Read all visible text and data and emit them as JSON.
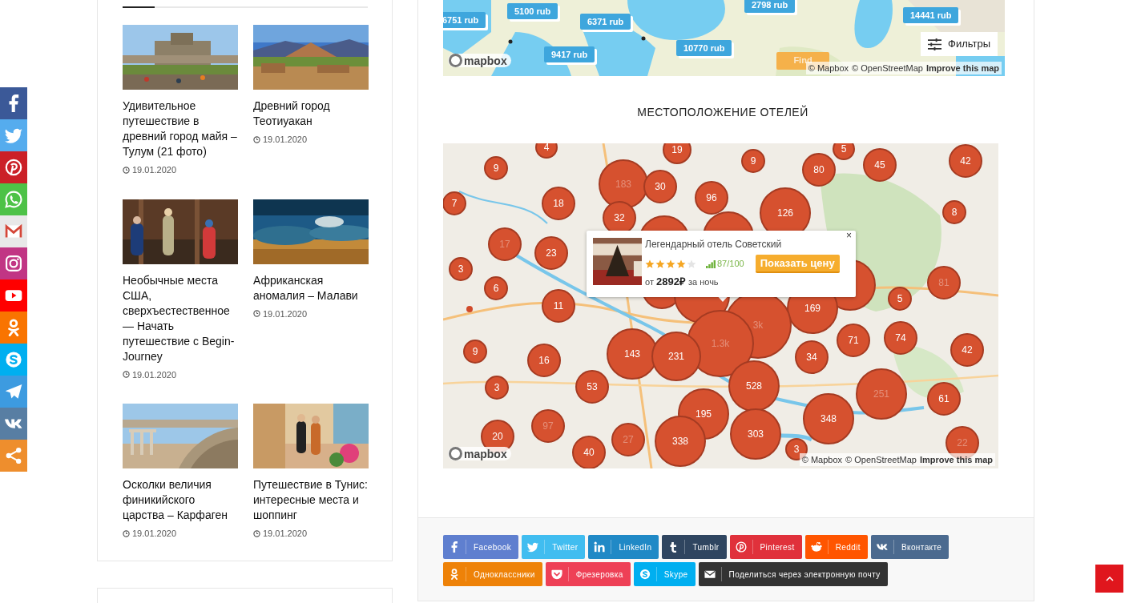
{
  "floating_share": [
    {
      "kind": "facebook",
      "color": "#3b5998"
    },
    {
      "kind": "twitter",
      "color": "#55acee"
    },
    {
      "kind": "pinterest",
      "color": "#cb2027"
    },
    {
      "kind": "whatsapp",
      "color": "#4dc247"
    },
    {
      "kind": "gmail",
      "color": "#e8e8e8"
    },
    {
      "kind": "instagram",
      "color": "#c13584"
    },
    {
      "kind": "youtube",
      "color": "#ff0000"
    },
    {
      "kind": "odnoklassniki",
      "color": "#f97400"
    },
    {
      "kind": "skype",
      "color": "#00aff0"
    },
    {
      "kind": "telegram",
      "color": "#3d9be0"
    },
    {
      "kind": "vk",
      "color": "#587ea3"
    },
    {
      "kind": "share",
      "color": "#ee8e2d"
    }
  ],
  "sidebar": {
    "posts": [
      {
        "title": "Удивительное путешествие в древний город майя – Тулум (21 фото)",
        "date": "19.01.2020"
      },
      {
        "title": "Древний город Теотиуакан",
        "date": "19.01.2020"
      },
      {
        "title": "Необычные места США, сверхъестественное — Начать путешествие с Begin-Journey",
        "date": "19.01.2020"
      },
      {
        "title": "Африканская аномалия – Малави",
        "date": "19.01.2020"
      },
      {
        "title": "Осколки величия финикийского царства – Карфаген",
        "date": "19.01.2020"
      },
      {
        "title": "Путешествие в Тунис: интересные места и шоппинг",
        "date": "19.01.2020"
      }
    ]
  },
  "price_map": {
    "markers": [
      "6751 rub",
      "5100 rub",
      "6371 rub",
      "2798 rub",
      "14441 rub",
      "9417 rub",
      "10770 rub"
    ],
    "find_button": "Find",
    "filters_button": "Фильтры",
    "logo": "mapbox",
    "attribution": [
      "© Mapbox",
      "© OpenStreetMap",
      "Improve this map"
    ]
  },
  "section_title": "МЕСТОПОЛОЖЕНИЕ ОТЕЛЕЙ",
  "hotel_map": {
    "clusters": [
      {
        "count": "4",
        "faded": false
      },
      {
        "count": "19",
        "faded": false
      },
      {
        "count": "9",
        "faded": false
      },
      {
        "count": "183",
        "faded": true
      },
      {
        "count": "30",
        "faded": false
      },
      {
        "count": "9",
        "faded": false
      },
      {
        "count": "5",
        "faded": false
      },
      {
        "count": "80",
        "faded": false
      },
      {
        "count": "45",
        "faded": false
      },
      {
        "count": "42",
        "faded": false
      },
      {
        "count": "7",
        "faded": false
      },
      {
        "count": "18",
        "faded": false
      },
      {
        "count": "96",
        "faded": false
      },
      {
        "count": "32",
        "faded": false
      },
      {
        "count": "126",
        "faded": false
      },
      {
        "count": "8",
        "faded": false
      },
      {
        "count": "17",
        "faded": true
      },
      {
        "count": "23",
        "faded": false
      },
      {
        "count": "3",
        "faded": false
      },
      {
        "count": "81",
        "faded": true
      },
      {
        "count": "6",
        "faded": false
      },
      {
        "count": "5",
        "faded": false
      },
      {
        "count": "11",
        "faded": false
      },
      {
        "count": "169",
        "faded": false
      },
      {
        "count": "3k",
        "faded": true
      },
      {
        "count": "1.3k",
        "faded": true
      },
      {
        "count": "9",
        "faded": false
      },
      {
        "count": "16",
        "faded": false
      },
      {
        "count": "143",
        "faded": false
      },
      {
        "count": "231",
        "faded": false
      },
      {
        "count": "34",
        "faded": false
      },
      {
        "count": "71",
        "faded": false
      },
      {
        "count": "74",
        "faded": false
      },
      {
        "count": "42",
        "faded": false
      },
      {
        "count": "3",
        "faded": false
      },
      {
        "count": "53",
        "faded": false
      },
      {
        "count": "528",
        "faded": false
      },
      {
        "count": "251",
        "faded": true
      },
      {
        "count": "61",
        "faded": false
      },
      {
        "count": "97",
        "faded": true
      },
      {
        "count": "20",
        "faded": false
      },
      {
        "count": "195",
        "faded": false
      },
      {
        "count": "27",
        "faded": true
      },
      {
        "count": "348",
        "faded": false
      },
      {
        "count": "338",
        "faded": false
      },
      {
        "count": "303",
        "faded": false
      },
      {
        "count": "40",
        "faded": false
      },
      {
        "count": "22",
        "faded": true
      },
      {
        "count": "3",
        "faded": false
      }
    ],
    "popup": {
      "hotel": "Легендарный отель Советский",
      "stars": 4,
      "rating": "87/100",
      "button": "Показать цену",
      "price": "от **2892₽** за ночь",
      "close": "×"
    },
    "logo": "mapbox",
    "attribution": [
      "© Mapbox",
      "© OpenStreetMap",
      "Improve this map"
    ]
  },
  "share_buttons": [
    {
      "label": "Facebook",
      "kind": "facebook",
      "color": "#5f7fcf"
    },
    {
      "label": "Twitter",
      "kind": "twitter",
      "color": "#41bdf0"
    },
    {
      "label": "LinkedIn",
      "kind": "linkedin",
      "color": "#2089c6"
    },
    {
      "label": "Tumblr",
      "kind": "tumblr",
      "color": "#2f4560"
    },
    {
      "label": "Pinterest",
      "kind": "pinterest",
      "color": "#e0313b"
    },
    {
      "label": "Reddit",
      "kind": "reddit",
      "color": "#ff5500"
    },
    {
      "label": "Вконтакте",
      "kind": "vk",
      "color": "#4b6a8f"
    },
    {
      "label": "Одноклассники",
      "kind": "odnoklassniki",
      "color": "#ee8208"
    },
    {
      "label": "Фрезеровка",
      "kind": "pocket",
      "color": "#ee4056"
    },
    {
      "label": "Skype",
      "kind": "skype",
      "color": "#00aff0"
    },
    {
      "label": "Поделиться через электронную почту",
      "kind": "email",
      "color": "#333333"
    }
  ],
  "scroll_top": true
}
